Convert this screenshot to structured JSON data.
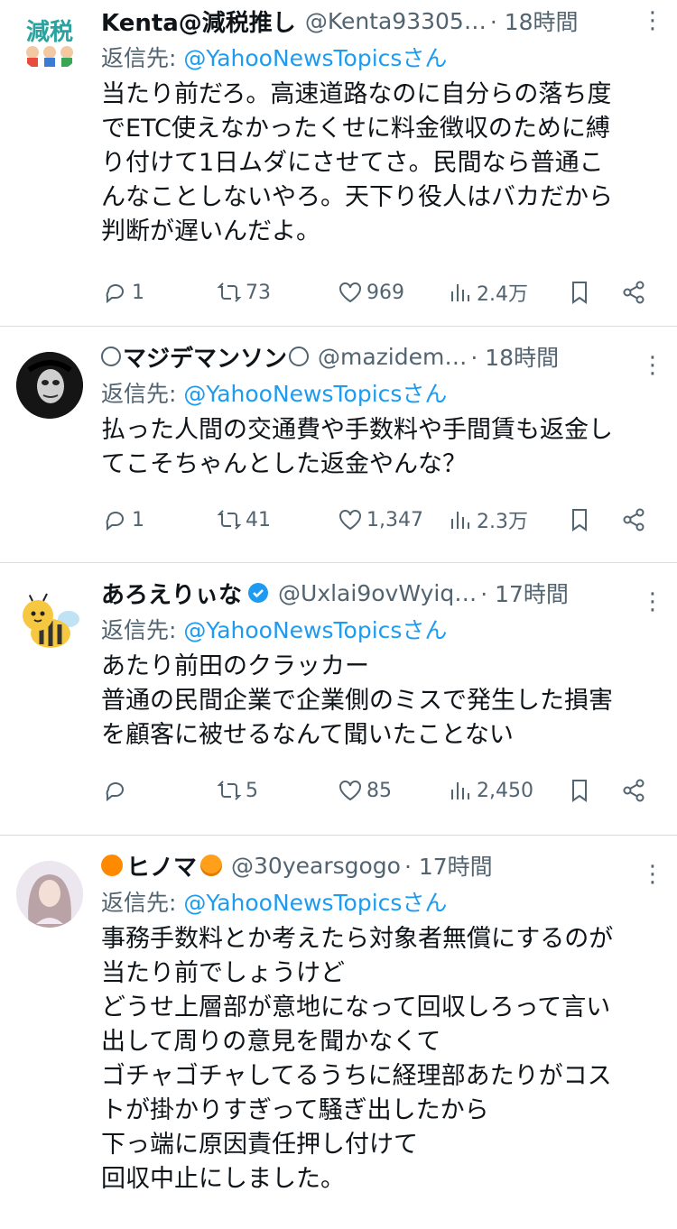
{
  "reply_prefix": "返信先: ",
  "tweets": [
    {
      "name": "Kenta@減税推し",
      "handle": "@Kenta93305…",
      "time": "· 18時間",
      "reply_to": "@YahooNewsTopicsさん",
      "avatar_text": "減税",
      "body": "当たり前だろ。高速道路なのに自分らの落ち度\nでETC使えなかったくせに料金徴収のために縛\nり付けて1日ムダにさせてさ。民間なら普通こ\nんなことしないやろ。天下り役人はバカだから\n判断が遅いんだよ。",
      "replies": "1",
      "retweets": "73",
      "likes": "969",
      "views": "2.4万"
    },
    {
      "name": "マジデマンソン",
      "handle": "@mazidem…",
      "time": "· 18時間",
      "reply_to": "@YahooNewsTopicsさん",
      "body": "払った人間の交通費や手数料や手間賃も返金し\nてこそちゃんとした返金やんな？",
      "replies": "1",
      "retweets": "41",
      "likes": "1,347",
      "views": "2.3万"
    },
    {
      "name": "あろえりぃな",
      "handle": "@Uxlai9ovWyiq…",
      "time": "· 17時間",
      "reply_to": "@YahooNewsTopicsさん",
      "body": "あたり前田のクラッカー\n普通の民間企業で企業側のミスで発生した損害\nを顧客に被せるなんて聞いたことない",
      "replies": "",
      "retweets": "5",
      "likes": "85",
      "views": "2,450"
    },
    {
      "name": "ヒノマ",
      "handle": "@30yearsgogo",
      "time": "· 17時間",
      "reply_to": "@YahooNewsTopicsさん",
      "body": "事務手数料とか考えたら対象者無償にするのが\n当たり前でしょうけど\nどうせ上層部が意地になって回収しろって言い\n出して周りの意見を聞かなくて\nゴチャゴチャしてるうちに経理部あたりがコス\nトが掛かりすぎって騒ぎ出したから\n下っ端に原因責任押し付けて\n回収中止にしました。"
    }
  ],
  "colors": {
    "link": "#1d9bf0",
    "muted": "#536471",
    "text": "#0f1419",
    "divider": "#d9dde0"
  },
  "icons": [
    "reply-icon",
    "retweet-icon",
    "like-icon",
    "views-icon",
    "bookmark-icon",
    "share-icon",
    "more-icon",
    "verified-icon"
  ]
}
